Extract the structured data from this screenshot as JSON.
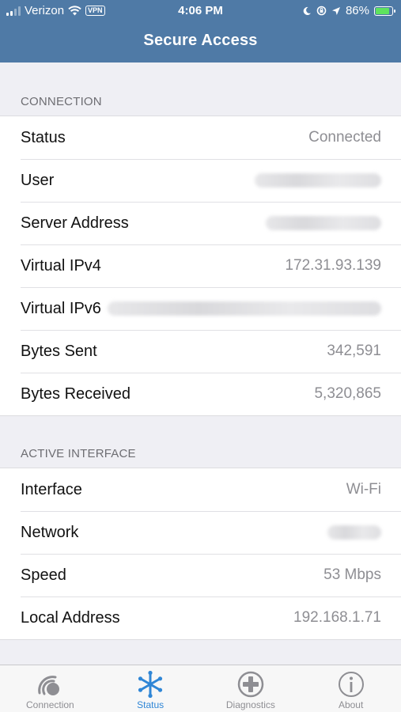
{
  "status_bar": {
    "carrier": "Verizon",
    "vpn": "VPN",
    "time": "4:06 PM",
    "battery": "86%",
    "battery_level": 0.86
  },
  "header": {
    "title": "Secure Access"
  },
  "connection": {
    "heading": "CONNECTION",
    "rows": [
      {
        "label": "Status",
        "value": "Connected"
      },
      {
        "label": "User",
        "value": ""
      },
      {
        "label": "Server Address",
        "value": ""
      },
      {
        "label": "Virtual IPv4",
        "value": "172.31.93.139"
      },
      {
        "label": "Virtual IPv6",
        "value": ""
      },
      {
        "label": "Bytes Sent",
        "value": "342,591"
      },
      {
        "label": "Bytes Received",
        "value": "5,320,865"
      }
    ]
  },
  "active_interface": {
    "heading": "ACTIVE INTERFACE",
    "rows": [
      {
        "label": "Interface",
        "value": "Wi-Fi"
      },
      {
        "label": "Network",
        "value": ""
      },
      {
        "label": "Speed",
        "value": "53 Mbps"
      },
      {
        "label": "Local Address",
        "value": "192.168.1.71"
      }
    ]
  },
  "tabs": [
    {
      "label": "Connection",
      "icon": "connection-icon",
      "active": false
    },
    {
      "label": "Status",
      "icon": "asterisk-icon",
      "active": true
    },
    {
      "label": "Diagnostics",
      "icon": "plus-circle-icon",
      "active": false
    },
    {
      "label": "About",
      "icon": "info-icon",
      "active": false
    }
  ],
  "colors": {
    "header": "#4f7aa6",
    "accent": "#2f86d6",
    "background": "#efeff4"
  }
}
